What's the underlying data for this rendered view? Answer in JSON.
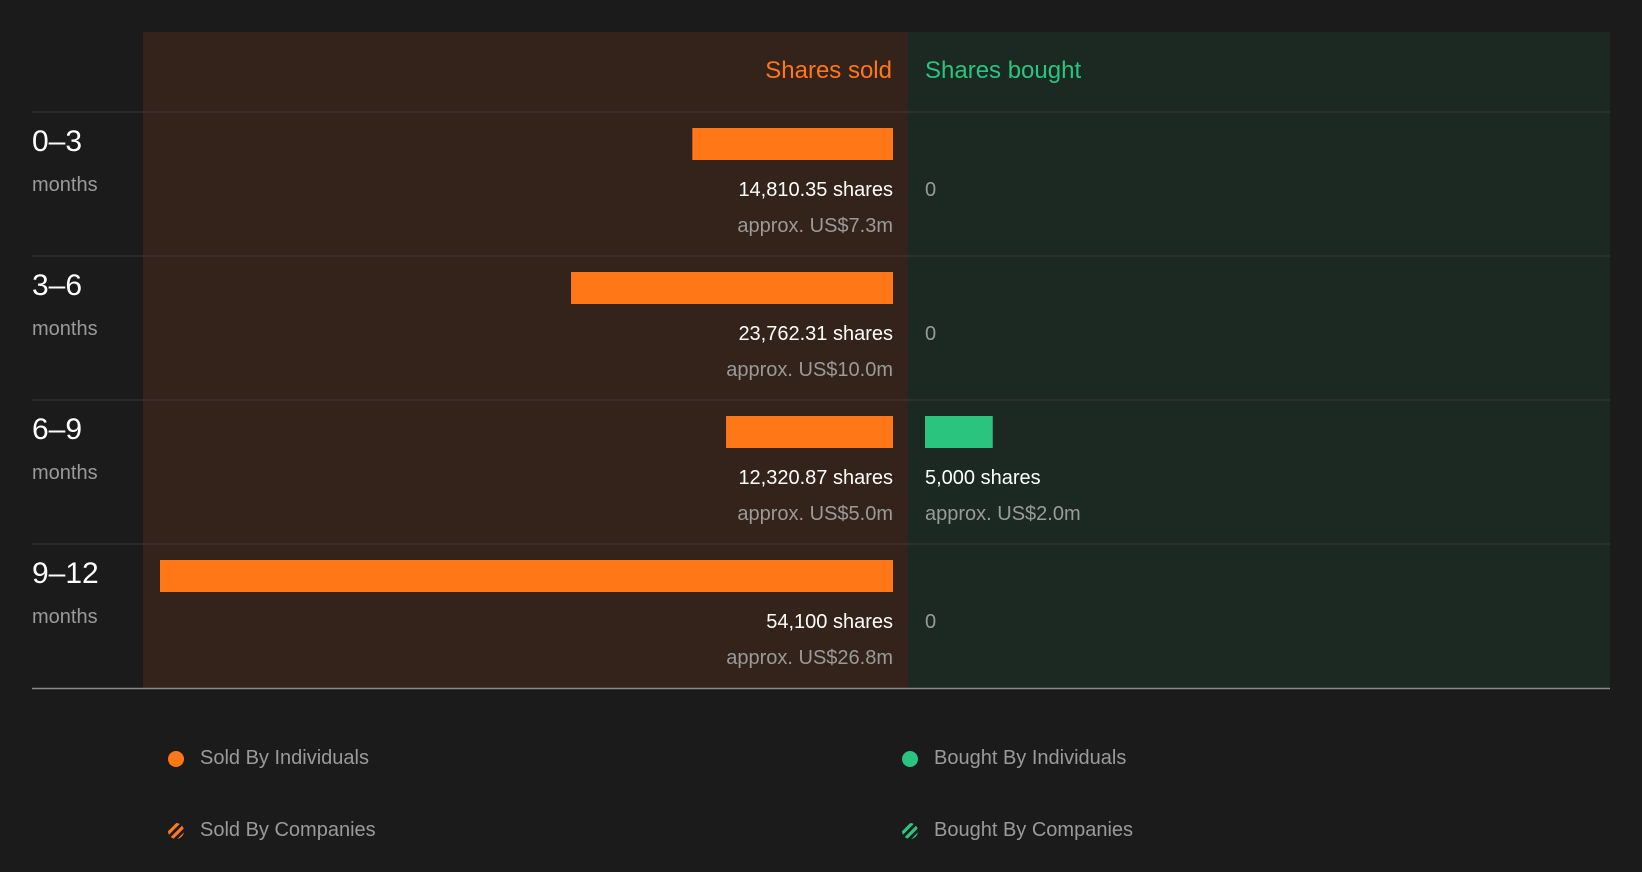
{
  "chart_data": {
    "type": "bar",
    "columns": {
      "sold_title": "Shares sold",
      "bought_title": "Shares bought"
    },
    "colors": {
      "sold": "#ff7717",
      "bought": "#2ac47e",
      "sold_bg": "#33231b",
      "bought_bg": "#1c2923",
      "page_bg": "#1b1b1b"
    },
    "periods": [
      {
        "range": "0–3",
        "unit": "months",
        "sold_shares": 14810.35,
        "sold_label": "14,810.35 shares",
        "sold_value": "approx. US$7.3m",
        "bought_shares": 0,
        "bought_label": "0",
        "bought_value": ""
      },
      {
        "range": "3–6",
        "unit": "months",
        "sold_shares": 23762.31,
        "sold_label": "23,762.31 shares",
        "sold_value": "approx. US$10.0m",
        "bought_shares": 0,
        "bought_label": "0",
        "bought_value": ""
      },
      {
        "range": "6–9",
        "unit": "months",
        "sold_shares": 12320.87,
        "sold_label": "12,320.87 shares",
        "sold_value": "approx. US$5.0m",
        "bought_shares": 5000,
        "bought_label": "5,000 shares",
        "bought_value": "approx. US$2.0m"
      },
      {
        "range": "9–12",
        "unit": "months",
        "sold_shares": 54100,
        "sold_label": "54,100 shares",
        "sold_value": "approx. US$26.8m",
        "bought_shares": 0,
        "bought_label": "0",
        "bought_value": ""
      }
    ],
    "max_shares": 54100
  },
  "legend": [
    {
      "label": "Sold By Individuals",
      "style": "solid",
      "color": "#ff7717"
    },
    {
      "label": "Bought By Individuals",
      "style": "solid",
      "color": "#2ac47e"
    },
    {
      "label": "Sold By Companies",
      "style": "striped",
      "color": "#ff7717"
    },
    {
      "label": "Bought By Companies",
      "style": "striped",
      "color": "#2ac47e"
    }
  ]
}
